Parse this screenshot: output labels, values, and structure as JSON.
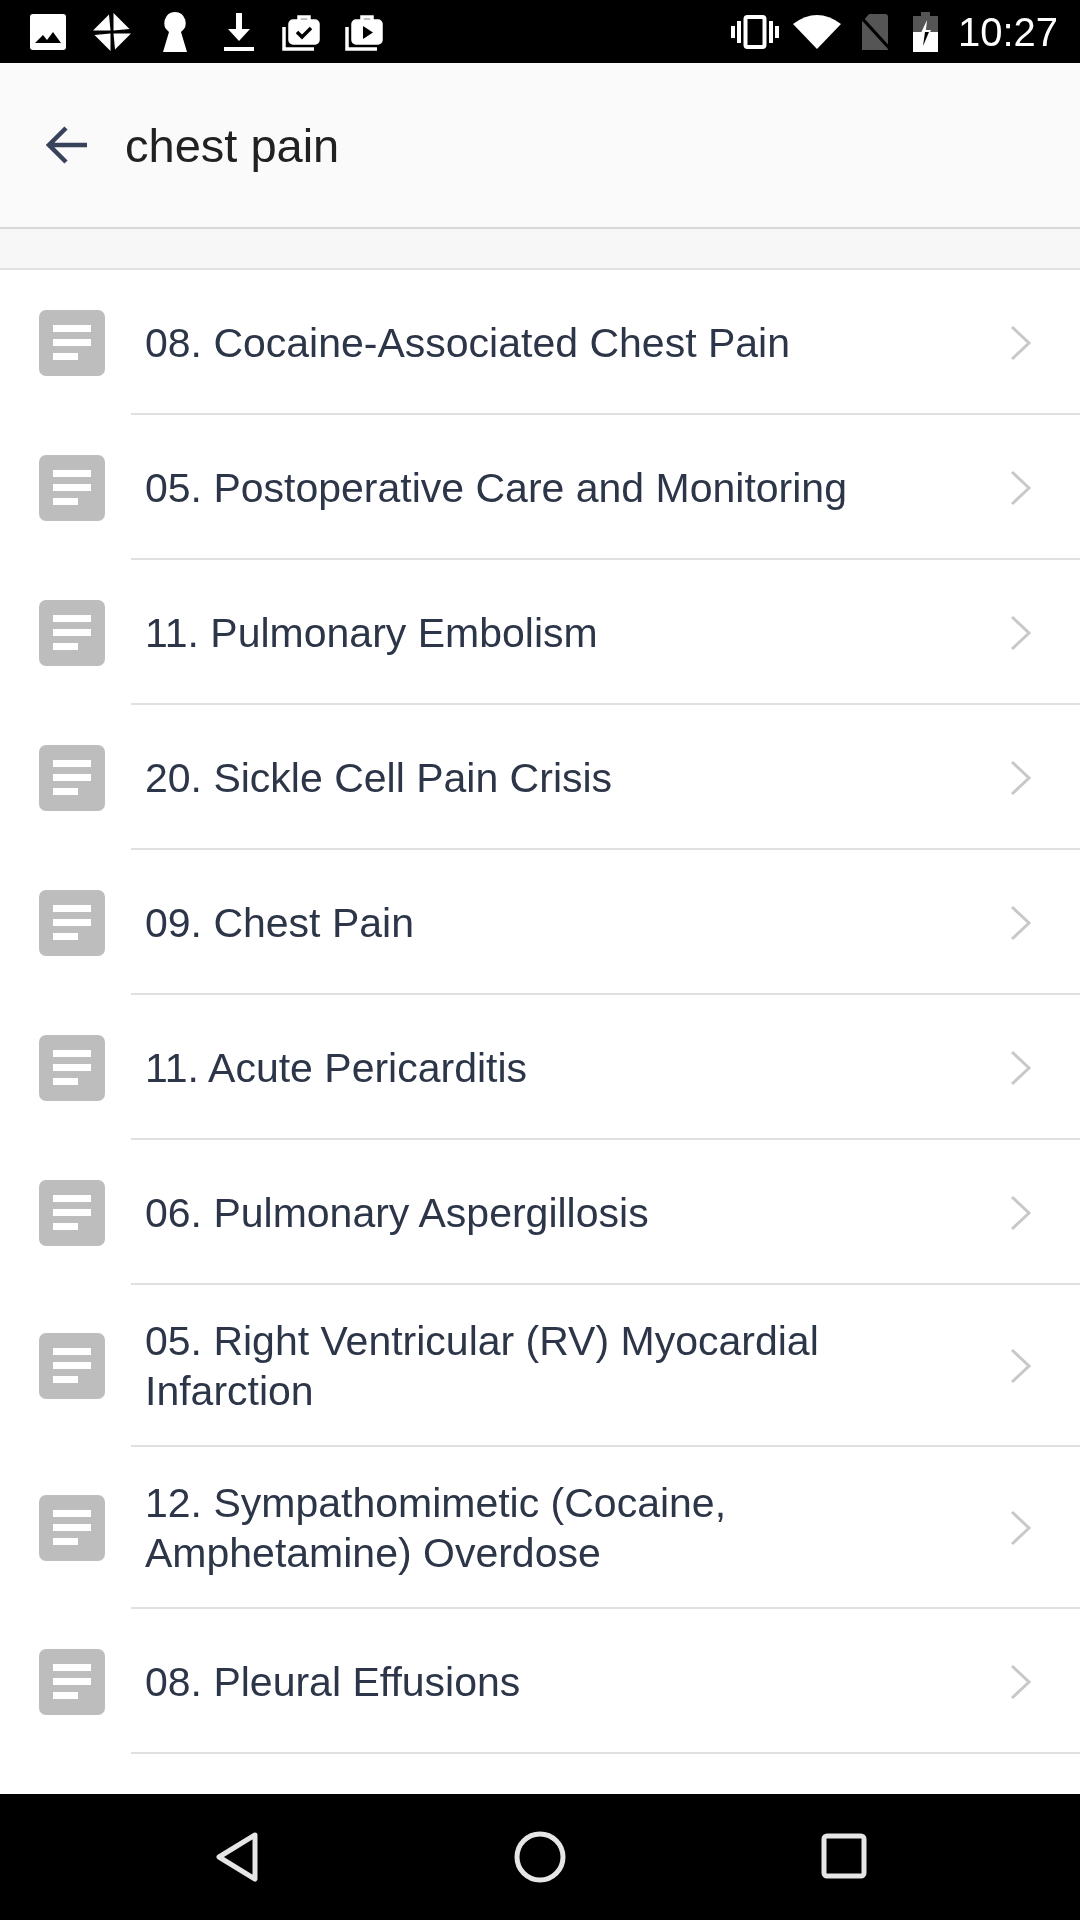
{
  "status_bar": {
    "time": "10:27"
  },
  "header": {
    "title": "chest pain"
  },
  "results": [
    {
      "title": "08. Cocaine-Associated Chest Pain"
    },
    {
      "title": "05. Postoperative Care and Monitoring"
    },
    {
      "title": "11. Pulmonary Embolism"
    },
    {
      "title": "20. Sickle Cell Pain Crisis"
    },
    {
      "title": "09. Chest Pain"
    },
    {
      "title": "11. Acute Pericarditis"
    },
    {
      "title": "06. Pulmonary Aspergillosis"
    },
    {
      "title": "05. Right Ventricular (RV) Myocardial Infarction"
    },
    {
      "title": "12. Sympathomimetic (Cocaine, Amphetamine) Overdose"
    },
    {
      "title": "08. Pleural Effusions"
    }
  ]
}
